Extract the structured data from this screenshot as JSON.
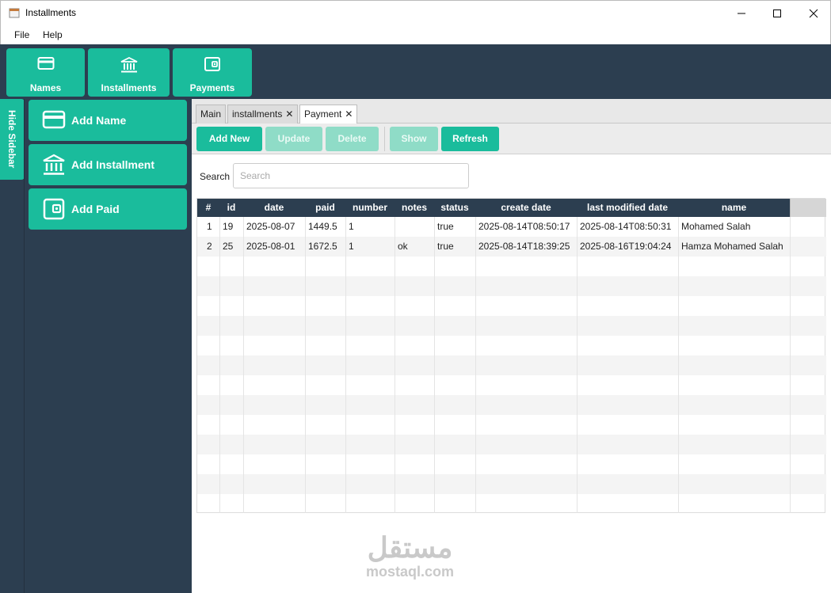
{
  "window": {
    "title": "Installments"
  },
  "menu": {
    "file": "File",
    "help": "Help"
  },
  "topnav": {
    "names": "Names",
    "installments": "Installments",
    "payments": "Payments"
  },
  "sidebar": {
    "toggle": "Hide Sidebar",
    "add_name": "Add Name",
    "add_installment": "Add Installment",
    "add_paid": "Add Paid"
  },
  "tabs": [
    {
      "label": "Main"
    },
    {
      "label": "installments"
    },
    {
      "label": "Payment"
    }
  ],
  "toolbar": {
    "add_new": "Add New",
    "update": "Update",
    "delete": "Delete",
    "show": "Show",
    "refresh": "Refresh"
  },
  "search": {
    "label": "Search",
    "placeholder": "Search"
  },
  "table": {
    "columns": [
      "#",
      "id",
      "date",
      "paid",
      "number",
      "notes",
      "status",
      "create date",
      "last modified date",
      "name"
    ],
    "rows": [
      [
        "1",
        "19",
        "2025-08-07",
        "1449.5",
        "1",
        "",
        "true",
        "2025-08-14T08:50:17",
        "2025-08-14T08:50:31",
        "Mohamed Salah"
      ],
      [
        "2",
        "25",
        "2025-08-01",
        "1672.5",
        "1",
        "ok",
        "true",
        "2025-08-14T18:39:25",
        "2025-08-16T19:04:24",
        "Hamza Mohamed Salah"
      ]
    ]
  },
  "watermark": {
    "arabic": "مستقل",
    "latin": "mostaql.com"
  },
  "colors": {
    "accent": "#1abc9c",
    "dark": "#2c3e50"
  },
  "icons": {
    "names": "credit-card-icon",
    "installments": "bank-icon",
    "payments": "wallet-icon"
  }
}
